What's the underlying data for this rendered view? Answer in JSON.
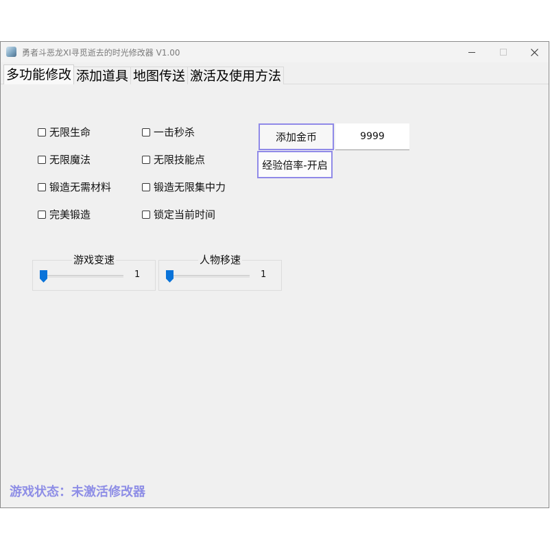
{
  "window": {
    "title": "勇者斗恶龙XI寻觅逝去的时光修改器 V1.00"
  },
  "tabs": [
    "多功能修改",
    "添加道具",
    "地图传送",
    "激活及使用方法"
  ],
  "cheats": {
    "col1": [
      "无限生命",
      "无限魔法",
      "锻造无需材料",
      "完美锻造"
    ],
    "col2": [
      "一击秒杀",
      "无限技能点",
      "锻造无限集中力",
      "锁定当前时间"
    ]
  },
  "gold": {
    "button_label": "添加金币",
    "value": "9999"
  },
  "exp": {
    "button_label": "经验倍率-开启"
  },
  "sliders": {
    "game_speed": {
      "label": "游戏变速",
      "value": "1"
    },
    "move_speed": {
      "label": "人物移速",
      "value": "1"
    }
  },
  "status": {
    "text": "游戏状态：未激活修改器"
  },
  "colors": {
    "accent_border": "#8f89e8",
    "status_text": "#8e8ee6",
    "slider_thumb": "#0a73d9"
  },
  "icons": [
    "app-icon",
    "minimize-icon",
    "maximize-icon",
    "close-icon",
    "checkbox-icon",
    "slider-thumb"
  ]
}
